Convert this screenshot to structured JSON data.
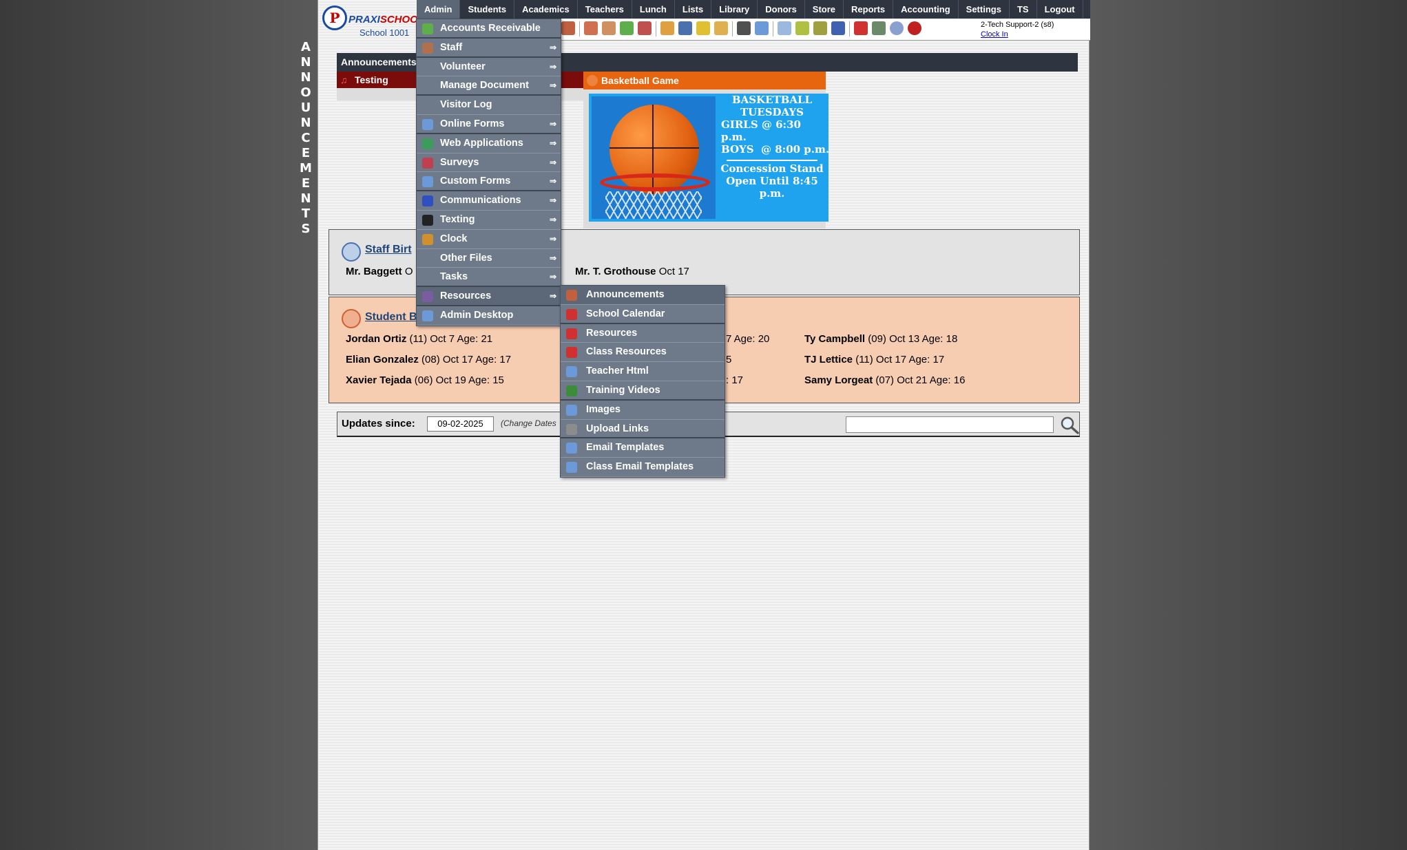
{
  "side_label": "ANNOUNCEMENTS",
  "logo": {
    "letter": "P",
    "brand_praxi": "PRAXI",
    "brand_school": "SCHOOL",
    "tm": "™",
    "school_name": "School 1001"
  },
  "nav": {
    "items": [
      {
        "label": "Admin",
        "active": true
      },
      {
        "label": "Students"
      },
      {
        "label": "Academics"
      },
      {
        "label": "Teachers"
      },
      {
        "label": "Lunch"
      },
      {
        "label": "Lists"
      },
      {
        "label": "Library"
      },
      {
        "label": "Donors"
      },
      {
        "label": "Store"
      },
      {
        "label": "Reports"
      },
      {
        "label": "Accounting"
      },
      {
        "label": "Settings"
      },
      {
        "label": "TS"
      },
      {
        "label": "Logout"
      }
    ]
  },
  "user": {
    "name": "2-Tech Support-2 (s8)",
    "clock_in": "Clock In"
  },
  "announcements": {
    "header": "Announcements",
    "testing_title": "Testing",
    "basketball_title": "Basketball Game",
    "basketball_text": {
      "line1": "BASKETBALL",
      "line2": "TUESDAYS",
      "line3": "GIRLS @ 6:30 p.m.",
      "line4": "BOYS  @ 8:00 p.m.",
      "line5": "Concession Stand",
      "line6": "Open Until 8:45 p.m."
    }
  },
  "staff_birthdays": {
    "title": "Staff Birt",
    "people": [
      {
        "name": "Mr. Baggett",
        "info": "O"
      },
      {
        "name": "Mr. T. Grothouse",
        "info": "Oct 17"
      }
    ]
  },
  "student_birthdays": {
    "title": "Student B",
    "col1": [
      {
        "name": "Jordan Ortiz",
        "info": "(11) Oct 7 Age: 21"
      },
      {
        "name": "Elian Gonzalez",
        "info": "(08) Oct 17 Age: 17"
      },
      {
        "name": "Xavier Tejada",
        "info": "(06) Oct 19 Age: 15"
      }
    ],
    "col2_partial": [
      "7 Age: 20",
      "5",
      ": 17"
    ],
    "col3": [
      {
        "name": "Ty Campbell",
        "info": "(09) Oct 13 Age: 18"
      },
      {
        "name": "TJ Lettice",
        "info": "(11) Oct 17 Age: 17"
      },
      {
        "name": "Samy Lorgeat",
        "info": "(07) Oct 21 Age: 16"
      }
    ]
  },
  "updates": {
    "label": "Updates since:",
    "date": "09-02-2025",
    "change_dates": "(Change Dates",
    "search_placeholder": ""
  },
  "admin_menu": {
    "items": [
      {
        "label": "Accounts Receivable",
        "icon": "money-icon",
        "color": "#5fae4c",
        "arrow": ""
      },
      {
        "label": "Staff",
        "icon": "staff-icon",
        "color": "#b07050",
        "arrow": "⇒"
      },
      {
        "label": "Volunteer",
        "icon": "",
        "color": "",
        "arrow": "⇒"
      },
      {
        "label": "Manage Document",
        "icon": "",
        "color": "",
        "arrow": "⇒"
      },
      {
        "label": "Visitor Log",
        "icon": "",
        "color": "",
        "arrow": ""
      },
      {
        "label": "Online Forms",
        "icon": "html-icon",
        "color": "#6c9ad8",
        "arrow": "⇒"
      },
      {
        "label": "Web Applications",
        "icon": "globe-icon",
        "color": "#3c9c5c",
        "arrow": "⇒"
      },
      {
        "label": "Surveys",
        "icon": "survey-icon",
        "color": "#c04050",
        "arrow": "⇒"
      },
      {
        "label": "Custom Forms",
        "icon": "html-icon",
        "color": "#6c9ad8",
        "arrow": "⇒"
      },
      {
        "label": "Communications",
        "icon": "at-icon",
        "color": "#3050c0",
        "arrow": "⇒"
      },
      {
        "label": "Texting",
        "icon": "phone-icon",
        "color": "#222222",
        "arrow": "⇒"
      },
      {
        "label": "Clock",
        "icon": "alarm-clock-icon",
        "color": "#d09030",
        "arrow": "⇒"
      },
      {
        "label": "Other Files",
        "icon": "",
        "color": "",
        "arrow": "⇒"
      },
      {
        "label": "Tasks",
        "icon": "",
        "color": "",
        "arrow": "⇒"
      },
      {
        "label": "Resources",
        "icon": "resources-icon",
        "color": "#7a5ca0",
        "arrow": "⇒"
      },
      {
        "label": "Admin Desktop",
        "icon": "desktop-icon",
        "color": "#6c9ad8",
        "arrow": ""
      }
    ]
  },
  "resources_menu": {
    "items": [
      {
        "label": "Announcements",
        "icon": "megaphone-icon",
        "color": "#c06040"
      },
      {
        "label": "School Calendar",
        "icon": "calendar-icon",
        "color": "#d03030"
      },
      {
        "label": "Resources",
        "icon": "pdf-icon",
        "color": "#d03030"
      },
      {
        "label": "Class Resources",
        "icon": "pdf-icon",
        "color": "#d03030"
      },
      {
        "label": "Teacher Html",
        "icon": "html-icon",
        "color": "#6c9ad8"
      },
      {
        "label": "Training Videos",
        "icon": "video-icon",
        "color": "#3c8c3c"
      },
      {
        "label": "Images",
        "icon": "images-icon",
        "color": "#6c9ad8"
      },
      {
        "label": "Upload Links",
        "icon": "upload-icon",
        "color": "#8c8c8c"
      },
      {
        "label": "Email Templates",
        "icon": "envelope-icon",
        "color": "#6c9ad8"
      },
      {
        "label": "Class Email Templates",
        "icon": "envelope-icon",
        "color": "#6c9ad8"
      }
    ]
  }
}
